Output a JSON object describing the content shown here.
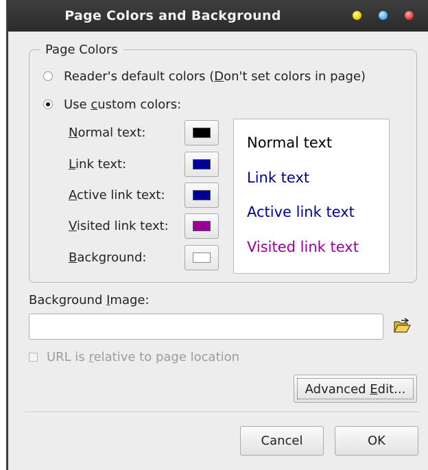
{
  "window": {
    "title": "Page Colors and Background"
  },
  "page_colors": {
    "legend": "Page Colors",
    "default_option": {
      "before": "Reader's default colors (",
      "mnemonic": "D",
      "after": "on't set colors in page)",
      "checked": false
    },
    "custom_option": {
      "before": "Use ",
      "mnemonic": "c",
      "after": "ustom colors:",
      "checked": true
    },
    "colors": [
      {
        "mnemonic": "N",
        "rest": "ormal text:",
        "color": "#000000"
      },
      {
        "mnemonic": "L",
        "rest": "ink text:",
        "color": "#000099"
      },
      {
        "mnemonic": "A",
        "rest": "ctive link text:",
        "color": "#000099"
      },
      {
        "mnemonic": "V",
        "rest": "isited link text:",
        "color": "#990099"
      },
      {
        "mnemonic": "B",
        "rest": "ackground:",
        "color": "#ffffff"
      }
    ],
    "preview": {
      "normal": "Normal text",
      "link": "Link text",
      "active": "Active link text",
      "visited": "Visited link text"
    }
  },
  "background_image": {
    "label_before": "Background ",
    "mnemonic": "I",
    "label_after": "mage:",
    "value": "",
    "placeholder": "",
    "folder_icon": "open-folder-icon"
  },
  "relative_url": {
    "before": "URL is ",
    "mnemonic": "r",
    "after": "elative to page location",
    "checked": false,
    "disabled": true
  },
  "buttons": {
    "advanced_before": "Advanced ",
    "advanced_mnemonic": "E",
    "advanced_after": "dit...",
    "cancel": "Cancel",
    "ok": "OK"
  }
}
